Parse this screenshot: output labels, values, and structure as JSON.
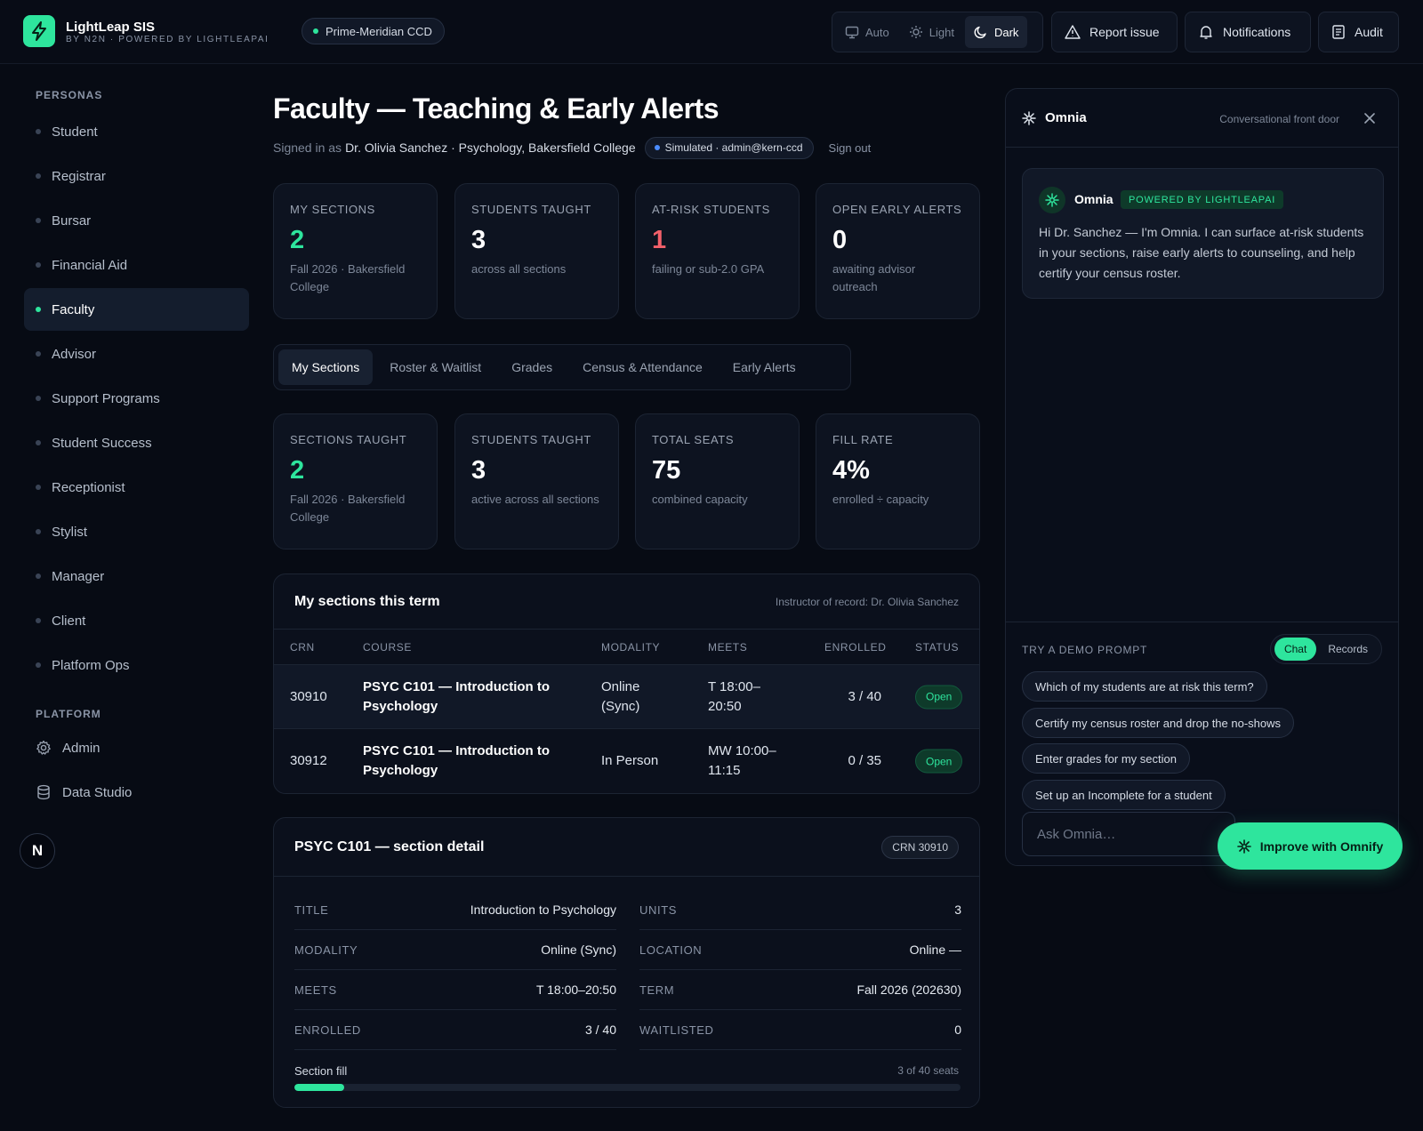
{
  "app": {
    "name": "LightLeap SIS",
    "tagline": "BY N2N · POWERED BY LIGHTLEAPAI",
    "tenant": "Prime-Meridian CCD"
  },
  "theme": {
    "options": [
      "Auto",
      "Light",
      "Dark"
    ],
    "selected": "Dark"
  },
  "topbar": {
    "report_label": "Report issue",
    "notifications_label": "Notifications",
    "audit_label": "Audit"
  },
  "sidebar": {
    "personas_heading": "PERSONAS",
    "personas": [
      "Student",
      "Registrar",
      "Bursar",
      "Financial Aid",
      "Faculty",
      "Advisor",
      "Support Programs",
      "Student Success",
      "Receptionist",
      "Stylist",
      "Manager",
      "Client",
      "Platform Ops"
    ],
    "active": "Faculty",
    "platform_heading": "PLATFORM",
    "platform_items": [
      "Admin",
      "Data Studio"
    ],
    "badge": "N"
  },
  "page": {
    "title": "Faculty — Teaching & Early Alerts",
    "signed_in_prefix": "Signed in as",
    "signed_in_user": "Dr. Olivia Sanchez · Psychology, Bakersfield College",
    "simulated": "Simulated · admin@kern-ccd",
    "sign_out": "Sign out"
  },
  "summary_stats": [
    {
      "label": "MY SECTIONS",
      "value": "2",
      "sub": "Fall 2026 · Bakersfield College",
      "tone": "green"
    },
    {
      "label": "STUDENTS TAUGHT",
      "value": "3",
      "sub": "across all sections",
      "tone": "default"
    },
    {
      "label": "AT-RISK STUDENTS",
      "value": "1",
      "sub": "failing or sub-2.0 GPA",
      "tone": "red"
    },
    {
      "label": "OPEN EARLY ALERTS",
      "value": "0",
      "sub": "awaiting advisor outreach",
      "tone": "default"
    }
  ],
  "tabs": [
    "My Sections",
    "Roster & Waitlist",
    "Grades",
    "Census & Attendance",
    "Early Alerts"
  ],
  "active_tab": "My Sections",
  "section_stats": [
    {
      "label": "SECTIONS TAUGHT",
      "value": "2",
      "sub": "Fall 2026 · Bakersfield College",
      "tone": "green"
    },
    {
      "label": "STUDENTS TAUGHT",
      "value": "3",
      "sub": "active across all sections",
      "tone": "default"
    },
    {
      "label": "TOTAL SEATS",
      "value": "75",
      "sub": "combined capacity",
      "tone": "default"
    },
    {
      "label": "FILL RATE",
      "value": "4%",
      "sub": "enrolled ÷ capacity",
      "tone": "default"
    }
  ],
  "sections_table": {
    "title": "My sections this term",
    "note": "Instructor of record: Dr. Olivia Sanchez",
    "columns": [
      "CRN",
      "COURSE",
      "MODALITY",
      "MEETS",
      "ENROLLED",
      "STATUS"
    ],
    "rows": [
      {
        "crn": "30910",
        "course": "PSYC C101 — Introduction to Psychology",
        "modality": "Online (Sync)",
        "meets": "T 18:00–20:50",
        "enrolled": "3 / 40",
        "status": "Open"
      },
      {
        "crn": "30912",
        "course": "PSYC C101 — Introduction to Psychology",
        "modality": "In Person",
        "meets": "MW 10:00–11:15",
        "enrolled": "0 / 35",
        "status": "Open"
      }
    ]
  },
  "section_detail": {
    "title": "PSYC C101 — section detail",
    "crn_chip": "CRN 30910",
    "left": [
      {
        "k": "TITLE",
        "v": "Introduction to Psychology"
      },
      {
        "k": "MODALITY",
        "v": "Online (Sync)"
      },
      {
        "k": "MEETS",
        "v": "T 18:00–20:50"
      },
      {
        "k": "ENROLLED",
        "v": "3 / 40"
      }
    ],
    "right": [
      {
        "k": "UNITS",
        "v": "3"
      },
      {
        "k": "LOCATION",
        "v": "Online —"
      },
      {
        "k": "TERM",
        "v": "Fall 2026 (202630)"
      },
      {
        "k": "WAITLISTED",
        "v": "0"
      }
    ],
    "fill_label": "Section fill",
    "fill_count": "3 of 40 seats",
    "fill_fraction": 0.075
  },
  "omnia": {
    "title": "Omnia",
    "subtitle": "Conversational front door",
    "message_sender": "Omnia",
    "powered_badge": "POWERED BY LIGHTLEAPAI",
    "message": "Hi Dr. Sanchez — I'm Omnia. I can surface at-risk students in your sections, raise early alerts to counseling, and help certify your census roster.",
    "demo_heading": "TRY A DEMO PROMPT",
    "modes": [
      "Chat",
      "Records"
    ],
    "active_mode": "Chat",
    "prompts": [
      "Which of my students are at risk this term?",
      "Certify my census roster and drop the no-shows",
      "Enter grades for my section",
      "Set up an Incomplete for a student"
    ],
    "input_placeholder": "Ask Omnia…",
    "omnify_label": "Improve with Omnify"
  },
  "colors": {
    "accent": "#2ee59d",
    "danger": "#f2606a",
    "background": "#070b14"
  }
}
